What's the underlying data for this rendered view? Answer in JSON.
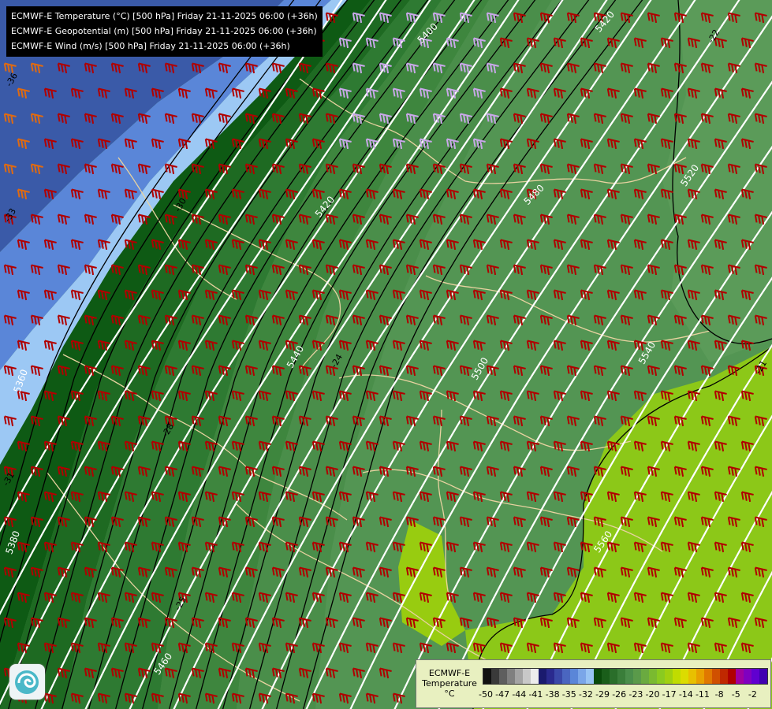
{
  "header": {
    "lines": [
      "ECMWF-E Temperature (°C) [500 hPa] Friday 21-11-2025 06:00 (+36h)",
      "ECMWF-E Geopotential (m) [500 hPa] Friday 21-11-2025 06:00 (+36h)",
      "ECMWF-E Wind (m/s) [500 hPa] Friday 21-11-2025 06:00 (+36h)"
    ]
  },
  "isohypse_labels": [
    "5400",
    "5420",
    "5440",
    "5460",
    "5480",
    "5500",
    "5520",
    "5540",
    "5560",
    "5380",
    "5360",
    "5420"
  ],
  "isotherm_labels": [
    "-36",
    "-33",
    "-30",
    "-28",
    "-25",
    "-24",
    "-22",
    "-21",
    "-31"
  ],
  "colorbar": {
    "title_lines": [
      "ECMWF-E",
      "Temperature",
      "°C"
    ],
    "ticks": [
      "-50",
      "-47",
      "-44",
      "-41",
      "-38",
      "-35",
      "-32",
      "-29",
      "-26",
      "-23",
      "-20",
      "-17",
      "-14",
      "-11",
      "-8",
      "-5",
      "-2"
    ],
    "colors": [
      "#111111",
      "#3a3a3a",
      "#5e5e5e",
      "#808080",
      "#a4a4a4",
      "#c8c8c8",
      "#ececec",
      "#1a1a6e",
      "#2a2a8e",
      "#3a48a8",
      "#4a66c0",
      "#5a86d8",
      "#7aa6e8",
      "#98c4f4",
      "#0a4a0a",
      "#1a5e1a",
      "#2a6e2a",
      "#3a7e3a",
      "#4a8e4a",
      "#5a9a4a",
      "#6aaa40",
      "#7aba30",
      "#8aca20",
      "#a0d010",
      "#c0dc00",
      "#dcdc00",
      "#e8c000",
      "#e8a000",
      "#e07800",
      "#d05000",
      "#c02800",
      "#b00000",
      "#a000a0",
      "#8000c0",
      "#6000d0",
      "#4000b0"
    ],
    "accent": "#b00000"
  },
  "layers": {
    "band_colors": [
      "#3a5aa8",
      "#5a86d8",
      "#9cc8f4",
      "#0e5a14",
      "#1e6a22",
      "#2e7a32",
      "#3e863e",
      "#4a8e4a",
      "#539553",
      "#5b9b59",
      "#8cc818",
      "#98cc10"
    ],
    "isohypse_color": "#ffffff",
    "isotherm_color": "#000000",
    "border_color": "#e8d2a0",
    "barb_color": "#b00000",
    "barb_color_weak": "#c8a8e8",
    "barb_color_orange": "#e06a10"
  },
  "logo": {
    "icon": "ecmwf-swirl-icon"
  }
}
